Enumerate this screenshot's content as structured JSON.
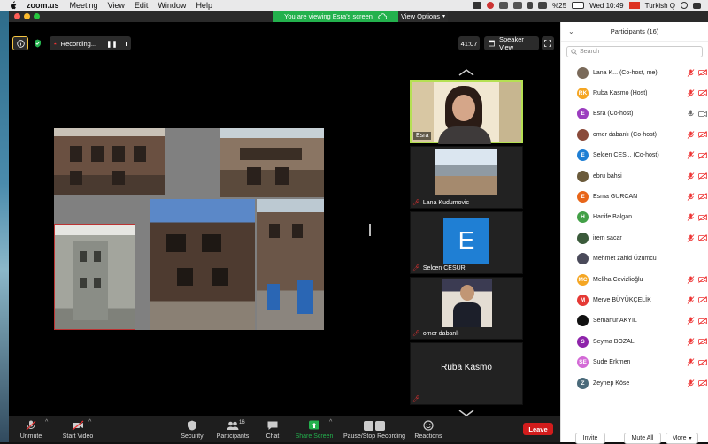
{
  "menubar": {
    "app_name": "zoom.us",
    "items": [
      "Meeting",
      "View",
      "Edit",
      "Window",
      "Help"
    ],
    "battery": "%25",
    "clock": "Wed 10:49",
    "input_source": "Turkish Q"
  },
  "banner": {
    "viewing_text": "You are viewing Esra's screen",
    "view_options": "View Options"
  },
  "top_controls": {
    "recording_label": "Recording...",
    "timer": "41:07",
    "view_mode": "Speaker View"
  },
  "thumbnails": [
    {
      "name": "Esra",
      "muted": false,
      "highlighted": true
    },
    {
      "name": "Lana Kudumovic",
      "muted": true
    },
    {
      "name": "Selcen CESUR",
      "muted": true,
      "initial": "E"
    },
    {
      "name": "omer dabanlı",
      "muted": true
    },
    {
      "name": "Ruba Kasmo",
      "muted": true,
      "text_only": "Ruba Kasmo"
    }
  ],
  "toolbar": {
    "unmute": "Unmute",
    "start_video": "Start Video",
    "security": "Security",
    "participants": "Participants",
    "participants_count": "16",
    "chat": "Chat",
    "share_screen": "Share Screen",
    "recording": "Pause/Stop Recording",
    "reactions": "Reactions",
    "leave": "Leave"
  },
  "panel": {
    "title": "Participants (16)",
    "search_placeholder": "Search",
    "participants": [
      {
        "name": "Lana K...  (Co-host, me)",
        "initials": "",
        "color": "#7a6a5a",
        "mic": "muted",
        "cam": "off"
      },
      {
        "name": "Ruba Kasmo (Host)",
        "initials": "RK",
        "color": "#f5a623",
        "mic": "muted",
        "cam": "off"
      },
      {
        "name": "Esra (Co-host)",
        "initials": "E",
        "color": "#9b3dbf",
        "mic": "on",
        "cam": "on"
      },
      {
        "name": "omer dabanlı (Co-host)",
        "initials": "",
        "color": "#8a4a3a",
        "mic": "muted",
        "cam": "off"
      },
      {
        "name": "Selcen CES... (Co-host)",
        "initials": "E",
        "color": "#1f7fd4",
        "mic": "muted",
        "cam": "off"
      },
      {
        "name": "ebru bahşi",
        "initials": "",
        "color": "#6b5b3b",
        "mic": "muted",
        "cam": "off"
      },
      {
        "name": "Esma GURCAN",
        "initials": "E",
        "color": "#e8661a",
        "mic": "muted",
        "cam": "off"
      },
      {
        "name": "Hanife Balgan",
        "initials": "H",
        "color": "#43a047",
        "mic": "muted",
        "cam": "off"
      },
      {
        "name": "irem sacar",
        "initials": "",
        "color": "#3a5a3a",
        "mic": "muted",
        "cam": "off"
      },
      {
        "name": "Mehmet zahid Üzümcü",
        "initials": "",
        "color": "#4a4a5a",
        "mic": "none",
        "cam": "none"
      },
      {
        "name": "Meliha Cevizlioğlu",
        "initials": "MC",
        "color": "#f5a623",
        "mic": "muted",
        "cam": "off"
      },
      {
        "name": "Merve BÜYÜKÇELİK",
        "initials": "M",
        "color": "#e53935",
        "mic": "muted",
        "cam": "off"
      },
      {
        "name": "Semanur AKYIL",
        "initials": "",
        "color": "#111111",
        "mic": "muted",
        "cam": "off"
      },
      {
        "name": "Seyma BOZAL",
        "initials": "S",
        "color": "#8e24aa",
        "mic": "muted",
        "cam": "off"
      },
      {
        "name": "Sude Erkmen",
        "initials": "SE",
        "color": "#d36ad6",
        "mic": "muted",
        "cam": "off"
      },
      {
        "name": "Zeynep Köse",
        "initials": "Z",
        "color": "#4a6a7a",
        "mic": "muted",
        "cam": "off"
      }
    ],
    "invite": "Invite",
    "mute_all": "Mute All",
    "more": "More"
  }
}
